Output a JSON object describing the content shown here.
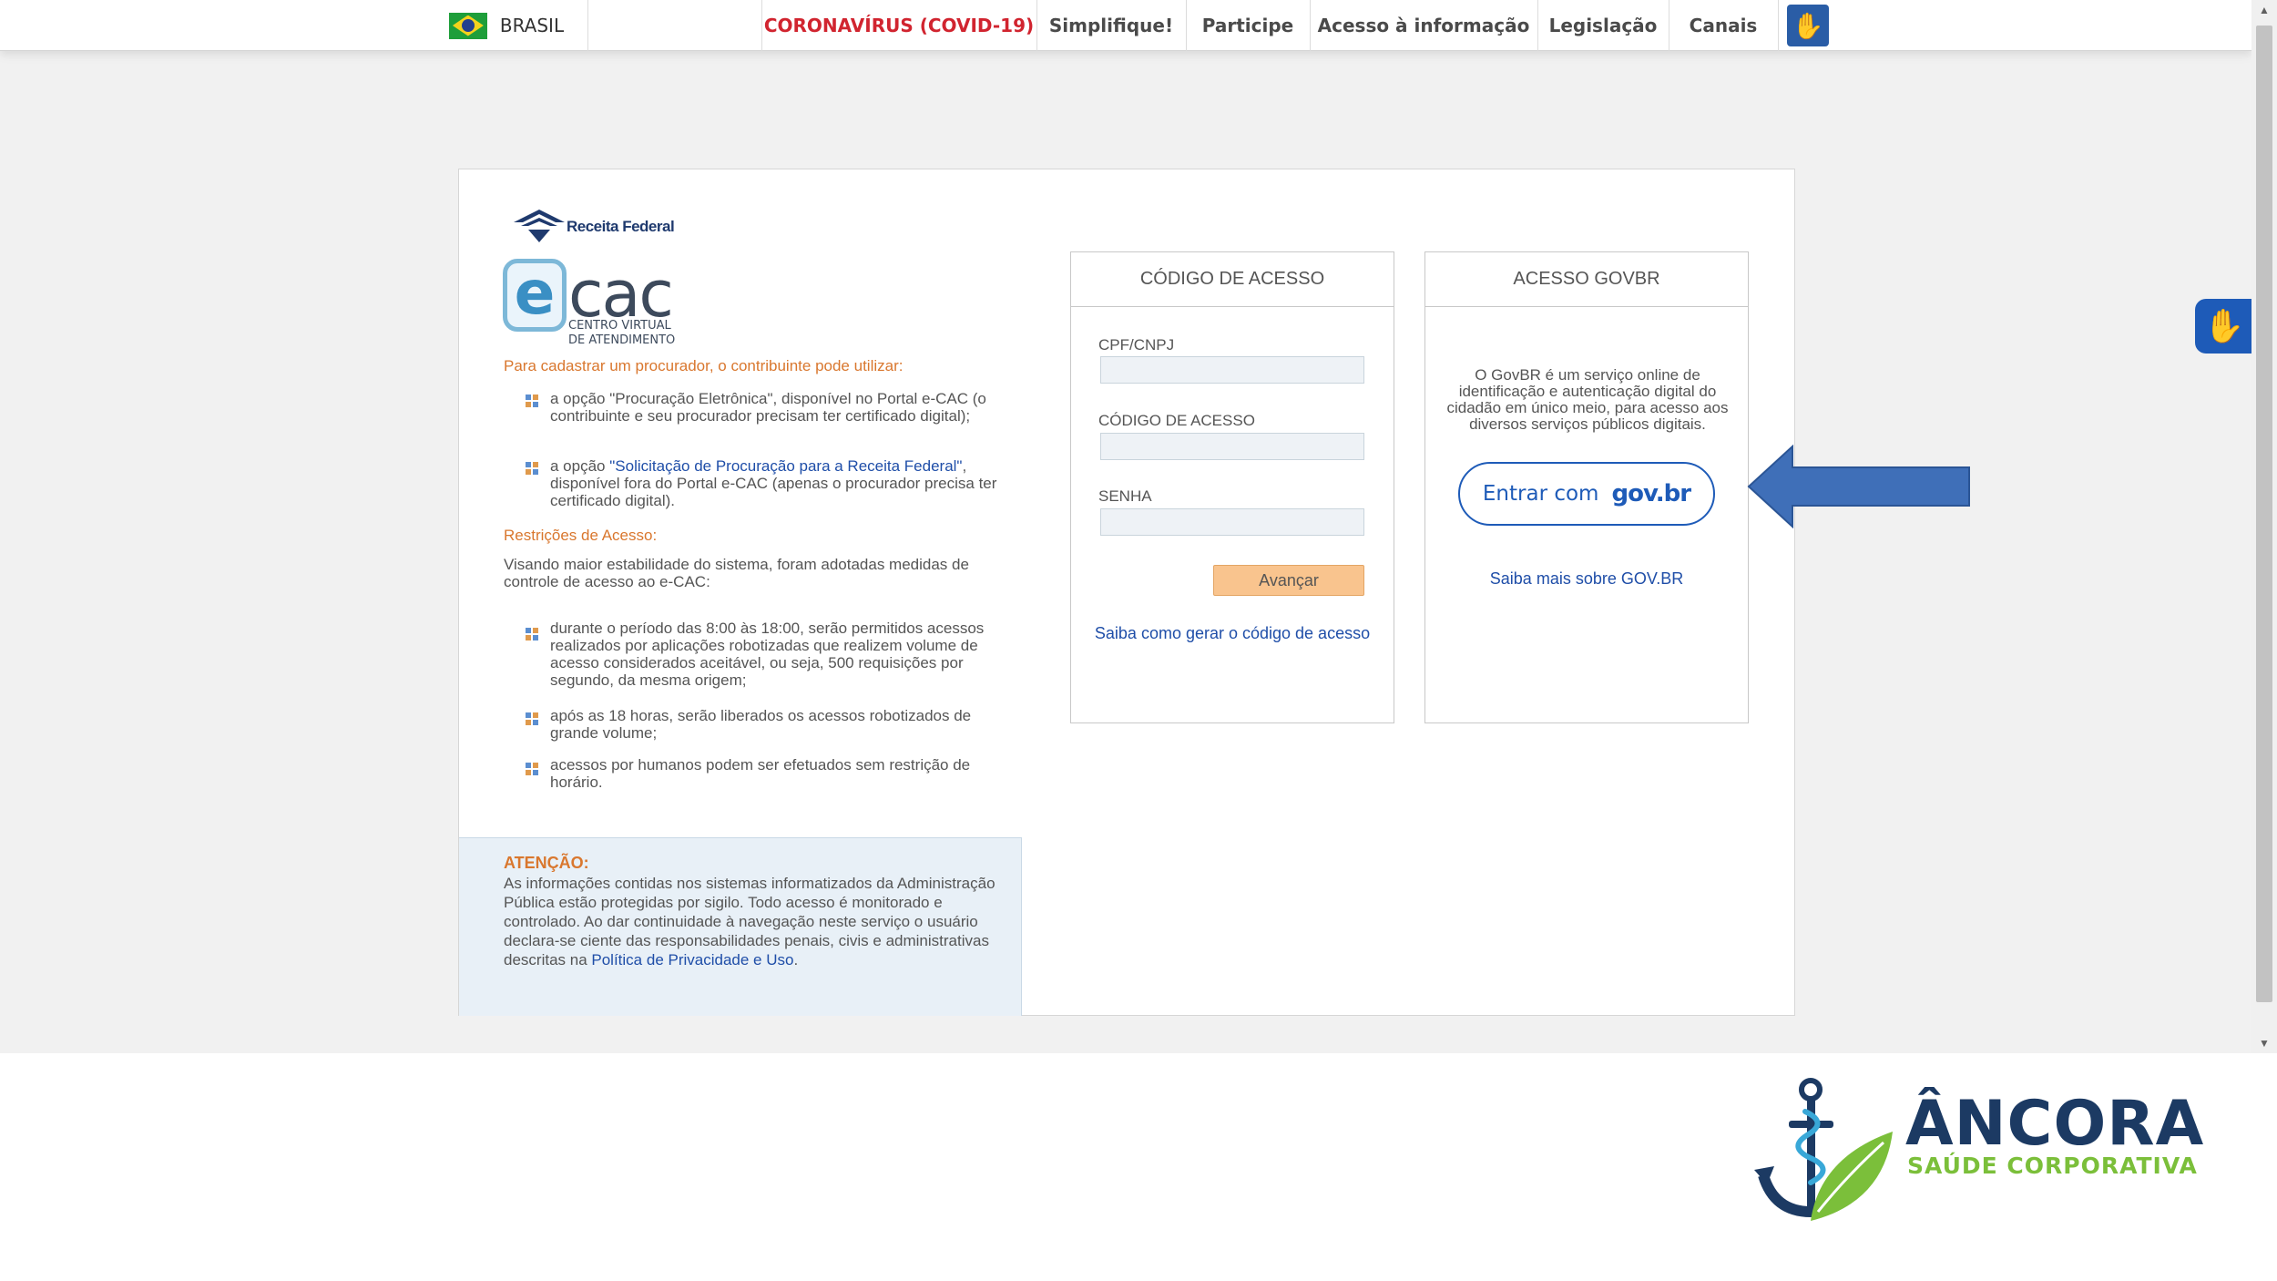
{
  "govbar": {
    "country": "BRASIL",
    "links": [
      "CORONAVÍRUS (COVID-19)",
      "Simplifique!",
      "Participe",
      "Acesso à informação",
      "Legislação",
      "Canais"
    ],
    "accessibility_icon": "hand-sign-icon",
    "covid_color": "#d1242f"
  },
  "left": {
    "rf_logo_text": "Receita Federal",
    "ecac_e": "e",
    "ecac_cac": "cac",
    "ecac_sub1": "CENTRO VIRTUAL",
    "ecac_sub2": "DE ATENDIMENTO",
    "intro": "Para cadastrar um procurador, o contribuinte pode utilizar:",
    "opt1": "a opção \"Procuração Eletrônica\", disponível no Portal e-CAC (o contribuinte e seu procurador precisam ter certificado digital);",
    "opt2_pre": "a opção ",
    "opt2_link": "\"Solicitação de Procuração para a Receita Federal\"",
    "opt2_post": ", disponível fora do Portal e-CAC (apenas o procurador precisa ter certificado digital).",
    "restricoes_title": "Restrições de Acesso:",
    "restricoes_intro": "Visando maior estabilidade do sistema, foram adotadas medidas de controle de acesso ao e-CAC:",
    "r1": "durante o período das 8:00 às 18:00, serão permitidos acessos realizados por aplicações robotizadas que realizem volume de acesso considerados aceitável, ou seja, 500 requisições por segundo, da mesma origem;",
    "r2": "após as 18 horas, serão liberados os acessos robotizados de grande volume;",
    "r3": "acessos por humanos podem ser efetuados sem restrição de horário."
  },
  "atencao": {
    "title": "ATENÇÃO:",
    "body": "As informações contidas nos sistemas informatizados da Administração Pública estão protegidas por sigilo. Todo acesso é monitorado e controlado. Ao dar continuidade à navegação neste serviço o usuário declara-se ciente das responsabilidades penais, civis e administrativas descritas na ",
    "link": "Política de Privacidade e Uso",
    "end": "."
  },
  "codigo_panel": {
    "title": "CÓDIGO DE ACESSO",
    "cpf_label": "CPF/CNPJ",
    "cpf_value": "",
    "codigo_label": "CÓDIGO DE ACESSO",
    "codigo_value": "",
    "senha_label": "SENHA",
    "senha_value": "",
    "submit": "Avançar",
    "help_link": "Saiba como gerar o código de acesso"
  },
  "govbr_panel": {
    "title": "ACESSO GOVBR",
    "description": "O GovBR é um serviço online de identificação e autenticação digital do cidadão em único meio, para acesso aos diversos serviços públicos digitais.",
    "button_text": "Entrar com",
    "button_logo": "gov.br",
    "more_link": "Saiba mais sobre GOV.BR"
  },
  "annotation": {
    "arrow_color": "#3f6fb8"
  },
  "brand": {
    "name": "ÂNCORA",
    "tagline": "SAÚDE CORPORATIVA",
    "primary_color": "#1c3a63",
    "accent_color": "#7bbf3a"
  }
}
